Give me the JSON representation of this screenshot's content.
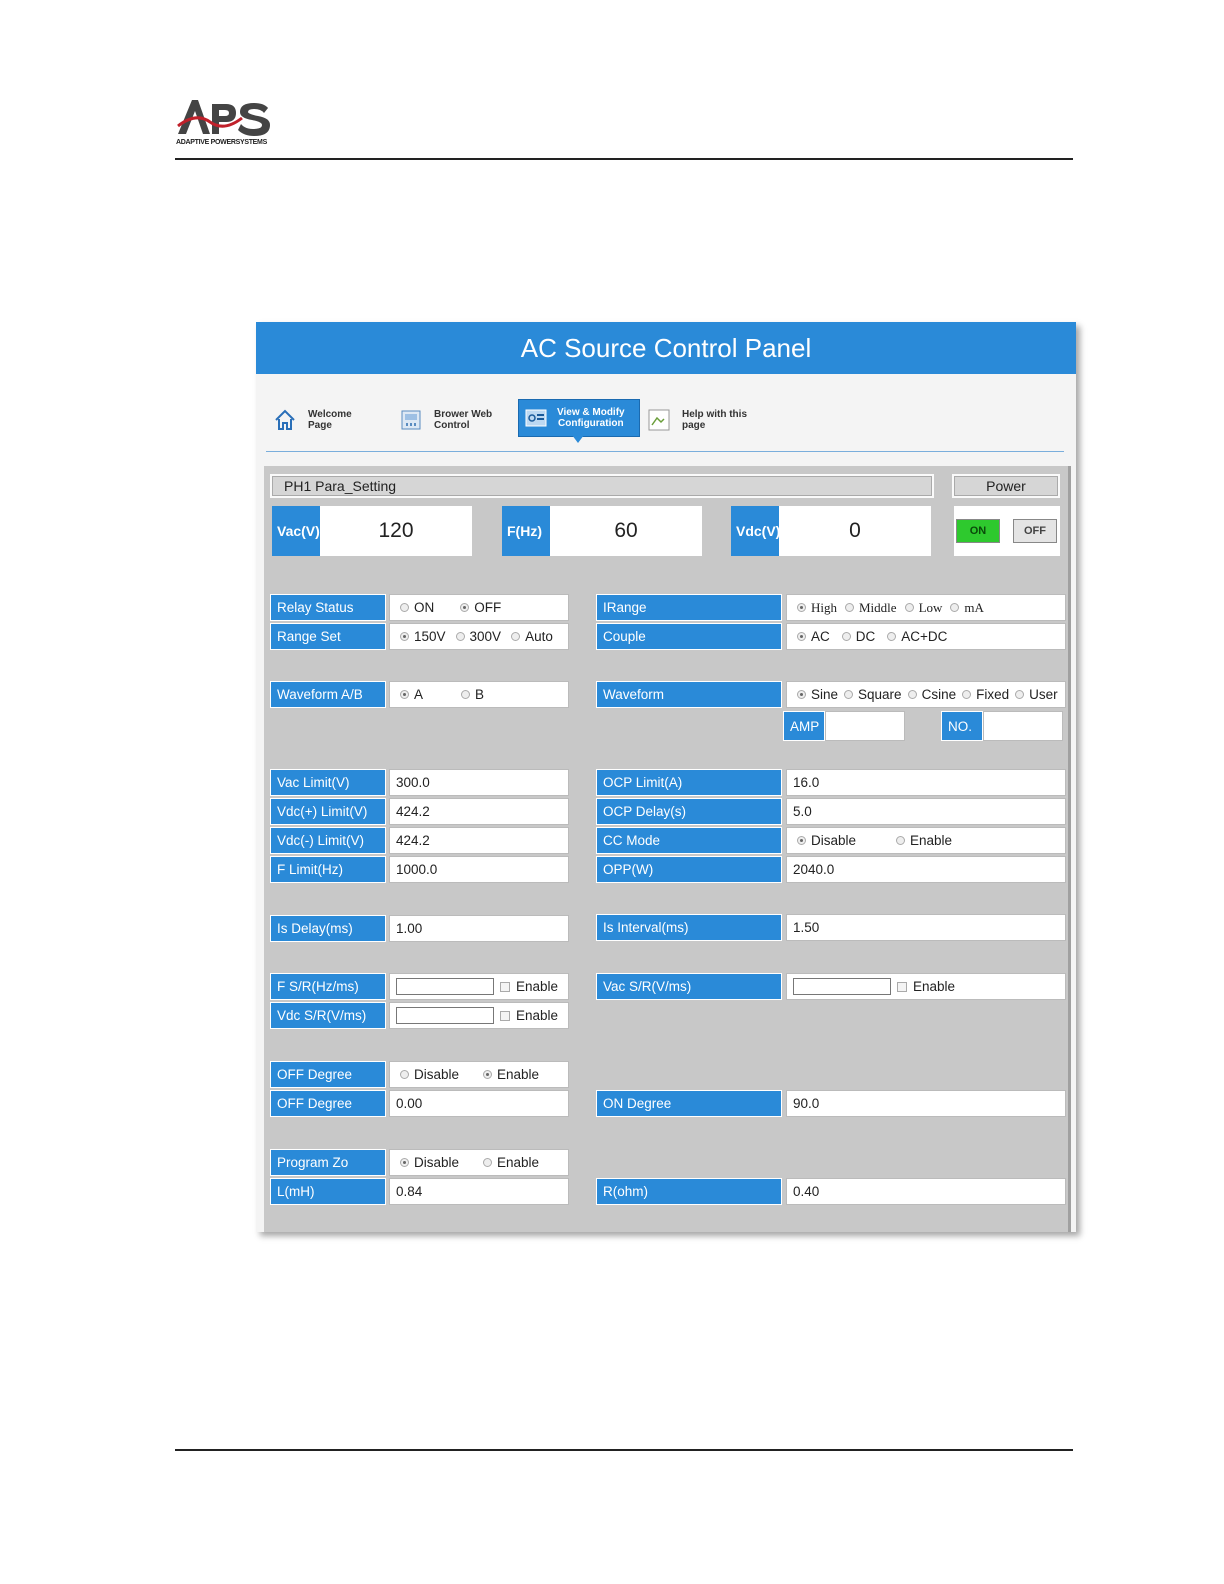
{
  "header": {
    "logo_text": "APS",
    "logo_subtitle": "ADAPTIVE POWERSYSTEMS"
  },
  "panel": {
    "title": "AC Source Control Panel"
  },
  "nav": {
    "items": [
      {
        "label": "Welcome\nPage",
        "icon": "home-icon"
      },
      {
        "label": "Brower Web\nControl",
        "icon": "web-control-icon"
      },
      {
        "label": "View & Modify\nConfiguration",
        "icon": "config-icon",
        "active": true
      },
      {
        "label": "Help with this\npage",
        "icon": "broken-image-icon"
      }
    ]
  },
  "phase": {
    "title": "PH1 Para_Setting",
    "power_label": "Power",
    "power_on": "ON",
    "power_off": "OFF",
    "vac_label": "Vac(V)",
    "vac_value": "120",
    "f_label": "F(Hz)",
    "f_value": "60",
    "vdc_label": "Vdc(V)",
    "vdc_value": "0"
  },
  "left": {
    "relay_status": {
      "label": "Relay Status",
      "options": [
        "ON",
        "OFF"
      ],
      "selected": "OFF"
    },
    "range_set": {
      "label": "Range Set",
      "options": [
        "150V",
        "300V",
        "Auto"
      ],
      "selected": "150V"
    },
    "waveform_ab": {
      "label": "Waveform A/B",
      "options": [
        "A",
        "B"
      ],
      "selected": "A"
    },
    "vac_limit": {
      "label": "Vac Limit(V)",
      "value": "300.0"
    },
    "vdc_plus_limit": {
      "label": "Vdc(+) Limit(V)",
      "value": "424.2"
    },
    "vdc_minus_limit": {
      "label": "Vdc(-) Limit(V)",
      "value": "424.2"
    },
    "f_limit": {
      "label": "F Limit(Hz)",
      "value": "1000.0"
    },
    "is_delay": {
      "label": "Is Delay(ms)",
      "value": "1.00"
    },
    "f_sr": {
      "label": "F S/R(Hz/ms)",
      "enable": "Enable"
    },
    "vdc_sr": {
      "label": "Vdc S/R(V/ms)",
      "enable": "Enable"
    },
    "off_degree_mode": {
      "label": "OFF Degree",
      "options": [
        "Disable",
        "Enable"
      ],
      "selected": "Enable"
    },
    "off_degree_value": {
      "label": "OFF Degree",
      "value": "0.00"
    },
    "program_zo": {
      "label": "Program Zo",
      "options": [
        "Disable",
        "Enable"
      ],
      "selected": "Disable"
    },
    "l_mh": {
      "label": "L(mH)",
      "value": "0.84"
    }
  },
  "right": {
    "irange": {
      "label": "IRange",
      "options": [
        "High",
        "Middle",
        "Low",
        "mA"
      ],
      "selected": "High"
    },
    "couple": {
      "label": "Couple",
      "options": [
        "AC",
        "DC",
        "AC+DC"
      ],
      "selected": "AC"
    },
    "waveform": {
      "label": "Waveform",
      "options": [
        "Sine",
        "Square",
        "Csine",
        "Fixed",
        "User"
      ],
      "selected": "Sine"
    },
    "amp_label": "AMP",
    "no_label": "NO.",
    "ocp_limit": {
      "label": "OCP Limit(A)",
      "value": "16.0"
    },
    "ocp_delay": {
      "label": "OCP Delay(s)",
      "value": "5.0"
    },
    "cc_mode": {
      "label": "CC Mode",
      "options": [
        "Disable",
        "Enable"
      ],
      "selected": "Disable"
    },
    "opp": {
      "label": "OPP(W)",
      "value": "2040.0"
    },
    "is_interval": {
      "label": "Is Interval(ms)",
      "value": "1.50"
    },
    "vac_sr": {
      "label": "Vac S/R(V/ms)",
      "enable": "Enable"
    },
    "on_degree": {
      "label": "ON Degree",
      "value": "90.0"
    },
    "r_ohm": {
      "label": "R(ohm)",
      "value": "0.40"
    }
  },
  "colors": {
    "accent": "#2a8ad8",
    "panel_bg": "#c8c8c8",
    "on_button": "#2ec92e"
  }
}
